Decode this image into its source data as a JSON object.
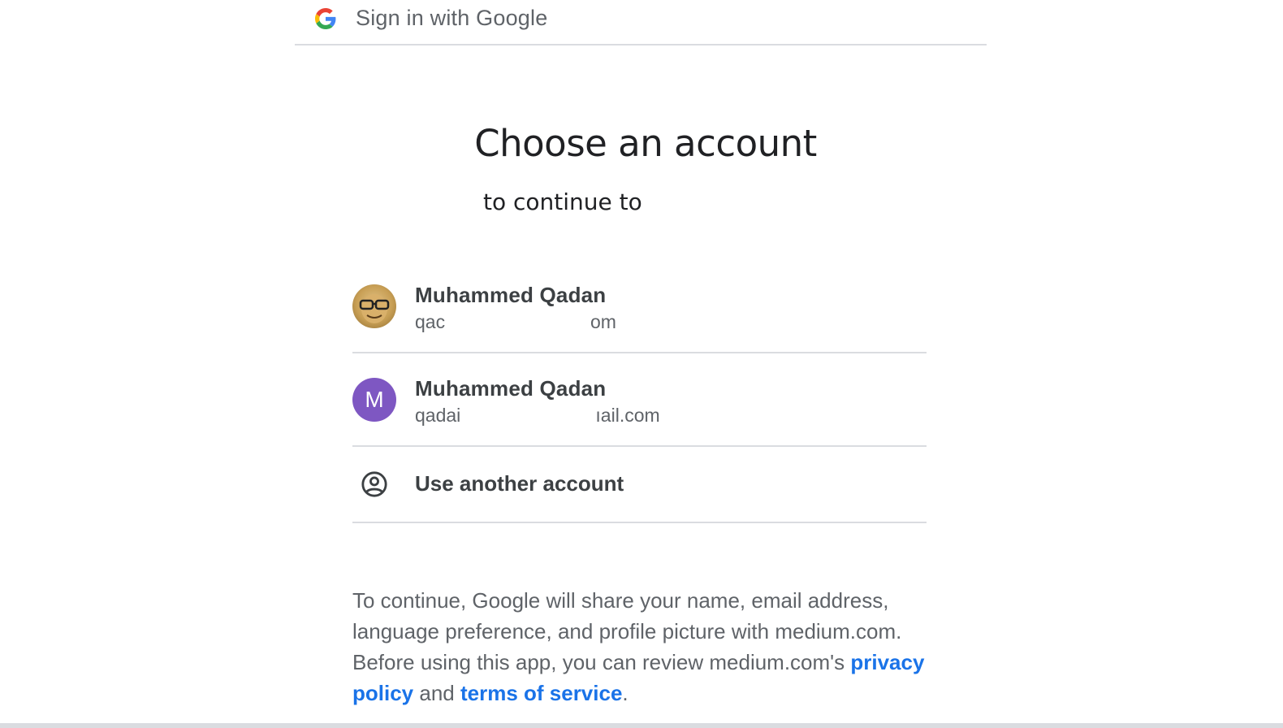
{
  "header": {
    "title": "Sign in with Google",
    "logo_icon": "google-g-icon"
  },
  "main": {
    "heading": "Choose an account",
    "subheading": "to continue to"
  },
  "accounts": [
    {
      "name": "Muhammed Qadan",
      "email": "qac                            om",
      "avatar": "photo"
    },
    {
      "name": "Muhammed Qadan",
      "email": "qadai                          ıail.com",
      "avatar_initial": "M",
      "avatar_color": "#7e57c2"
    }
  ],
  "other_account": {
    "label": "Use another account",
    "icon": "account-circle-icon"
  },
  "notice": {
    "text_1": "To continue, Google will share your name, email address, language preference, and profile picture with medium.com. Before using this app, you can review medium.com's ",
    "privacy_link": "privacy policy",
    "and": " and ",
    "terms_link": "terms of service",
    "end": "."
  },
  "colors": {
    "link": "#1a73e8",
    "text_secondary": "#5f6368",
    "divider": "#dadce0"
  }
}
